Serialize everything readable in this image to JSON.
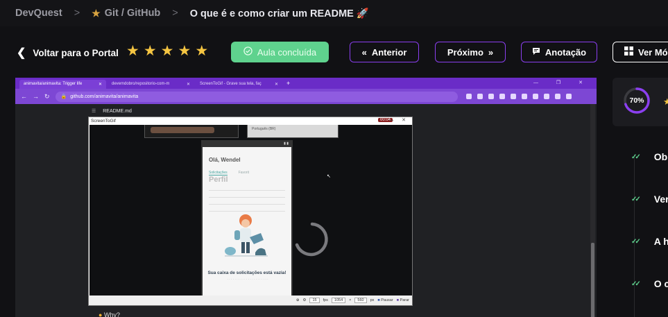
{
  "breadcrumb": {
    "home": "DevQuest",
    "section": "Git / GitHub",
    "current": "O que é e como criar um README 🚀",
    "separator": ">"
  },
  "toolbar": {
    "back_label": "Voltar para o Portal",
    "rating": 5,
    "rating_max": 5,
    "done_label": "Aula concluída",
    "prev_label": "Anterior",
    "next_label": "Próximo",
    "note_label": "Anotação",
    "modules_label": "Ver Mó"
  },
  "colors": {
    "accent": "#8b3ff0",
    "success": "#5fd28e",
    "star": "#f5c542",
    "browser_tabbar": "#6a2cc7",
    "background": "#111114"
  },
  "video": {
    "browser_tabs": [
      "animavita/animavita: Trigger life",
      "devemdobro/repositorio-com-m",
      "ScreenToGif - Grave sua tela, faç"
    ],
    "url": "github.com/animavita/animavita",
    "readme_file": "README.md",
    "screentogif": {
      "title": "ScreenToGif",
      "timer": "00:04",
      "fps_value": "15",
      "fps_unit": "fps",
      "width": "1054",
      "height": "560",
      "size_unit": "px",
      "pause_label": "Pausar",
      "stop_label": "Parar"
    },
    "phone": {
      "greeting": "Olá, Wendel",
      "tab_requests": "Solicitações",
      "tab_favorites": "Favorit",
      "section": "Perfil",
      "empty_title": "Sua caixa de solicitações está vazia!",
      "card_language": "Português (BR)"
    },
    "below_text": "Why?"
  },
  "progress": {
    "percent": 70,
    "label": "70%"
  },
  "lessons": [
    {
      "label": "Ob",
      "done": true
    },
    {
      "label": "Ver",
      "done": true
    },
    {
      "label": "A h",
      "done": true
    },
    {
      "label": "O c",
      "done": true
    }
  ]
}
